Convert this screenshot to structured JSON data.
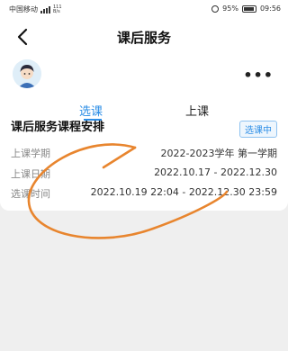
{
  "status_bar": {
    "carrier": "中国移动",
    "network_speed": "111\nB/s",
    "battery": "95%",
    "time": "09:56"
  },
  "nav": {
    "title": "课后服务"
  },
  "tabs": [
    {
      "label": "选课"
    },
    {
      "label": "上课"
    }
  ],
  "card": {
    "title": "课后服务课程安排",
    "status": "选课中",
    "rows": [
      {
        "label": "上课学期",
        "value": "2022-2023学年 第一学期"
      },
      {
        "label": "上课日期",
        "value": "2022.10.17 - 2022.12.30"
      },
      {
        "label": "选课时间",
        "value": "2022.10.19 22:04 - 2022.12.30 23:59"
      }
    ]
  },
  "colors": {
    "accent": "#2b8de6",
    "annotation": "#e8852e"
  }
}
